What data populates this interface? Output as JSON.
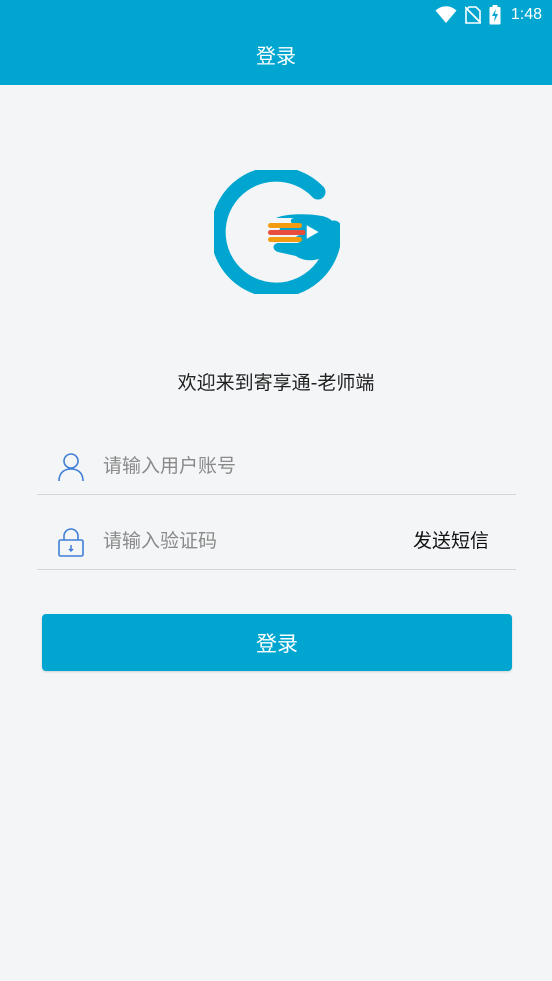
{
  "status_bar": {
    "time": "1:48",
    "icons": [
      "wifi-icon",
      "no-sim-icon",
      "battery-charging-icon"
    ]
  },
  "header": {
    "title": "登录"
  },
  "logo": {
    "icon": "app-logo-icon"
  },
  "welcome_text": "欢迎来到寄享通-老师端",
  "form": {
    "account": {
      "icon": "user-icon",
      "value": "",
      "placeholder": "请输入用户账号"
    },
    "code": {
      "icon": "lock-icon",
      "value": "",
      "placeholder": "请输入验证码",
      "send_sms_label": "发送短信"
    },
    "login_label": "登录"
  },
  "colors": {
    "primary": "#00a6d0",
    "background": "#f4f5f7",
    "icon_blue": "#3f7fd6",
    "logo_orange": "#f39c12",
    "logo_red": "#e74c3c"
  }
}
